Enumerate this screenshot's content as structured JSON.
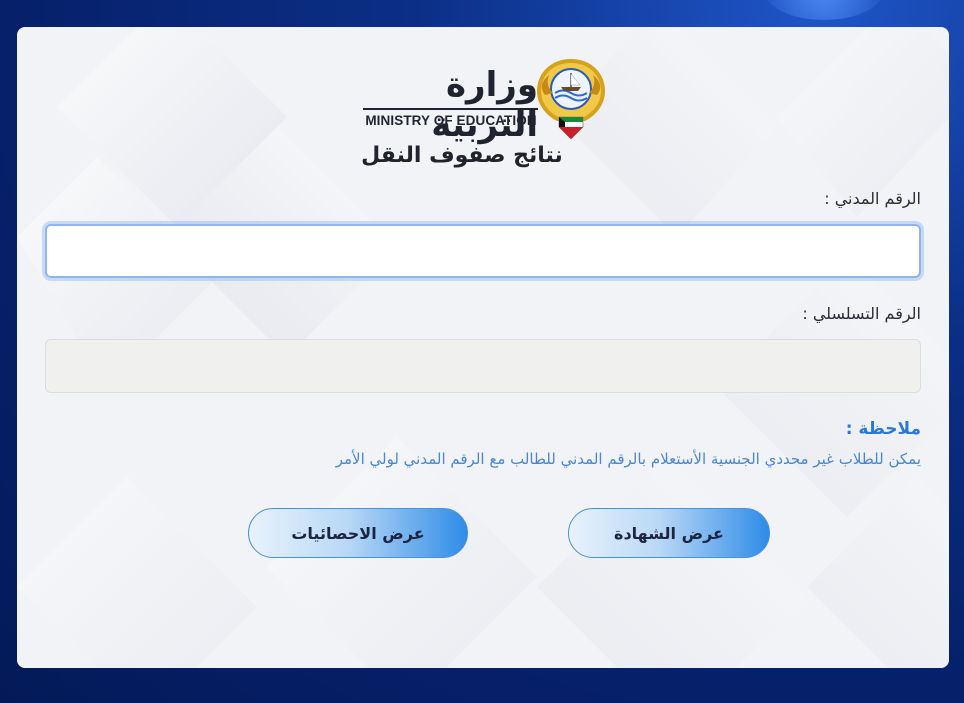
{
  "header": {
    "ministry_ar": "وزارة التربية",
    "ministry_en": "MINISTRY OF EDUCATION",
    "page_title": "نتائج صفوف النقل"
  },
  "form": {
    "civil_id_label": "الرقم المدني :",
    "civil_id_value": "",
    "serial_label": "الرقم التسلسلي :",
    "serial_value": ""
  },
  "note": {
    "title": "ملاحظة :",
    "text": "يمكن للطلاب غير محددي الجنسية الأستعلام بالرقم المدني للطالب مع الرقم المدني لولي الأمر"
  },
  "buttons": {
    "view_certificate": "عرض الشهادة",
    "view_statistics": "عرض الاحصائيات"
  },
  "colors": {
    "background": "#0b2f86",
    "accent": "#2f8ce8",
    "note": "#2a78d8",
    "emblem_green": "#1a8a3a",
    "emblem_red": "#c8202a",
    "emblem_gold": "#d6a21e"
  },
  "icons": {
    "emblem": "kuwait-state-emblem"
  }
}
